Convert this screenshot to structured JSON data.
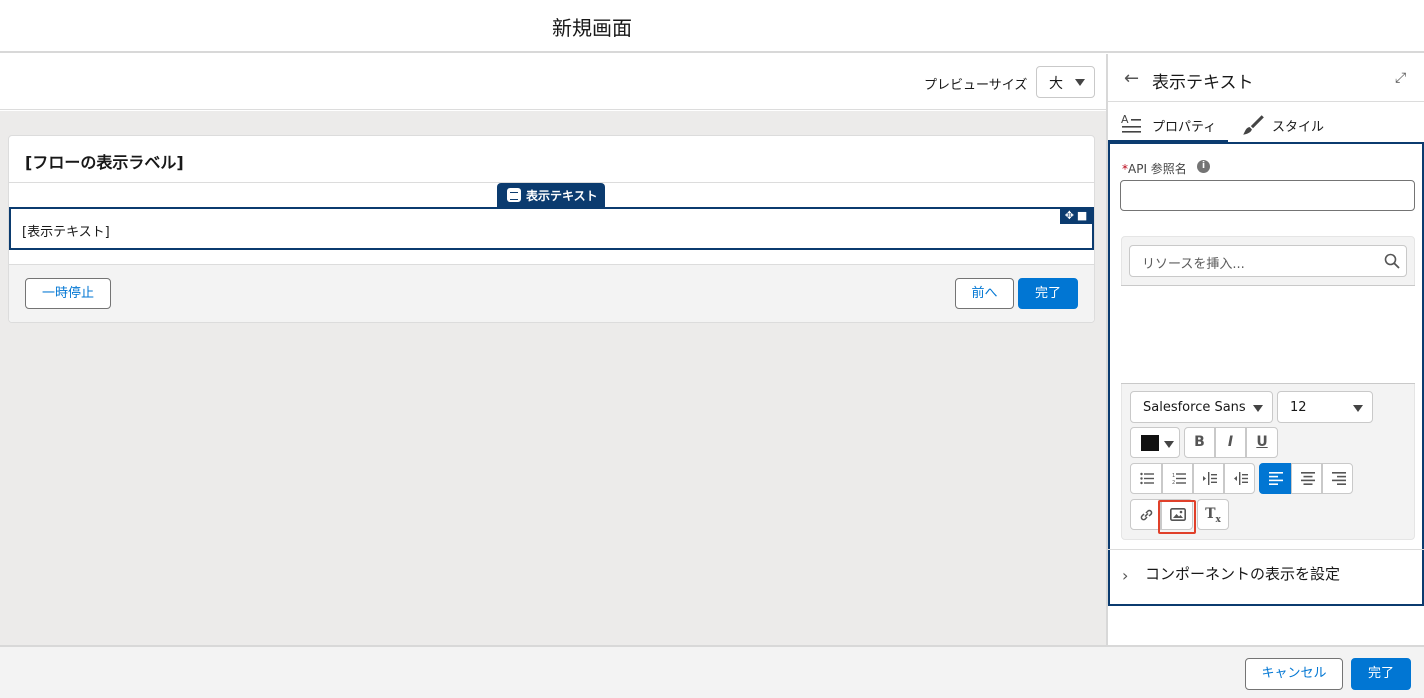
{
  "header": {
    "title": "新規画面"
  },
  "preview": {
    "size_label": "プレビューサイズ",
    "size_value": "大"
  },
  "flow_card": {
    "title": "[フローの表示ラベル]",
    "display_tag": "表示テキスト",
    "display_text": "[表示テキスト]",
    "pause_label": "一時停止",
    "prev_label": "前へ",
    "finish_label": "完了"
  },
  "panel": {
    "title": "表示テキスト",
    "tabs": [
      {
        "label": "プロパティ"
      },
      {
        "label": "スタイル"
      }
    ],
    "api_label": "API 参照名",
    "api_required_mark": "*",
    "api_value": "",
    "resource_placeholder": "リソースを挿入...",
    "font_family": "Salesforce Sans",
    "font_size": "12",
    "text_color": "#111111",
    "toolbar": {
      "bold": "B",
      "italic": "I",
      "underline": "U",
      "clear": "Tx"
    },
    "component_visibility_label": "コンポーネントの表示を設定"
  },
  "footer": {
    "cancel_label": "キャンセル",
    "done_label": "完了"
  },
  "colors": {
    "brand": "#0176d3",
    "navy": "#0b3b6f",
    "highlight": "#e0402a"
  }
}
